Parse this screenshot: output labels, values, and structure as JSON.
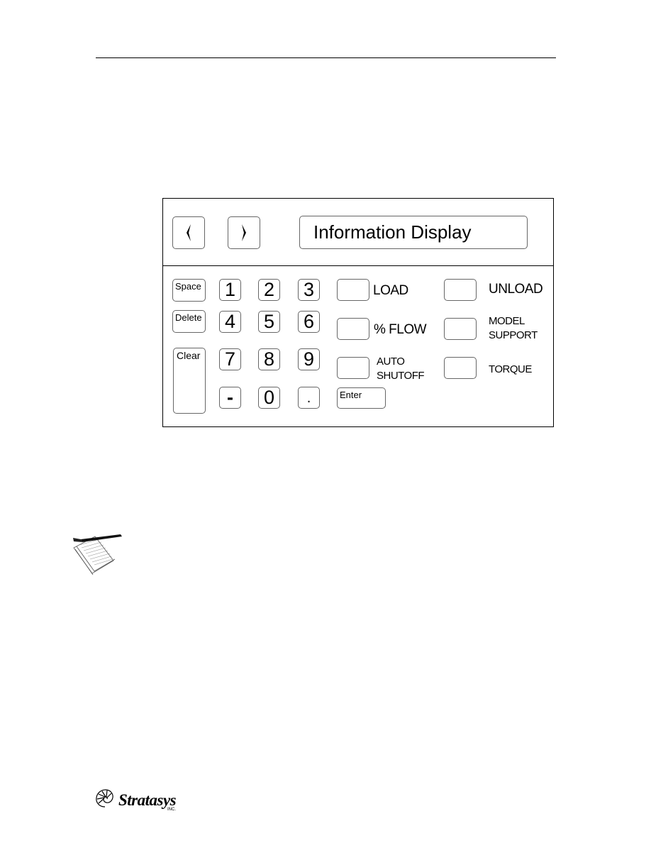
{
  "page": {
    "header_rule": true
  },
  "keypad": {
    "nav": {
      "left_icon": "chevron-left-icon",
      "right_icon": "chevron-right-icon"
    },
    "display": {
      "label": "Information Display"
    },
    "function_keys": {
      "space": "Space",
      "delete": "Delete",
      "clear": "Clear"
    },
    "numeric_keys": [
      "1",
      "2",
      "3",
      "4",
      "5",
      "6",
      "7",
      "8",
      "9",
      "-",
      "0",
      "."
    ],
    "enter": "Enter",
    "control_keys": [
      {
        "label": "LOAD"
      },
      {
        "label": "% FLOW"
      },
      {
        "label_line1": "AUTO",
        "label_line2": "SHUTOFF"
      },
      {
        "label": "UNLOAD"
      },
      {
        "label_line1": "MODEL",
        "label_line2": "SUPPORT"
      },
      {
        "label": "TORQUE"
      }
    ]
  },
  "note": {
    "icon": "notepad-pen-icon"
  },
  "footer": {
    "logo_text": "Stratasys",
    "logo_suffix": "INC.",
    "logo_icon": "nautilus-shell-icon"
  }
}
